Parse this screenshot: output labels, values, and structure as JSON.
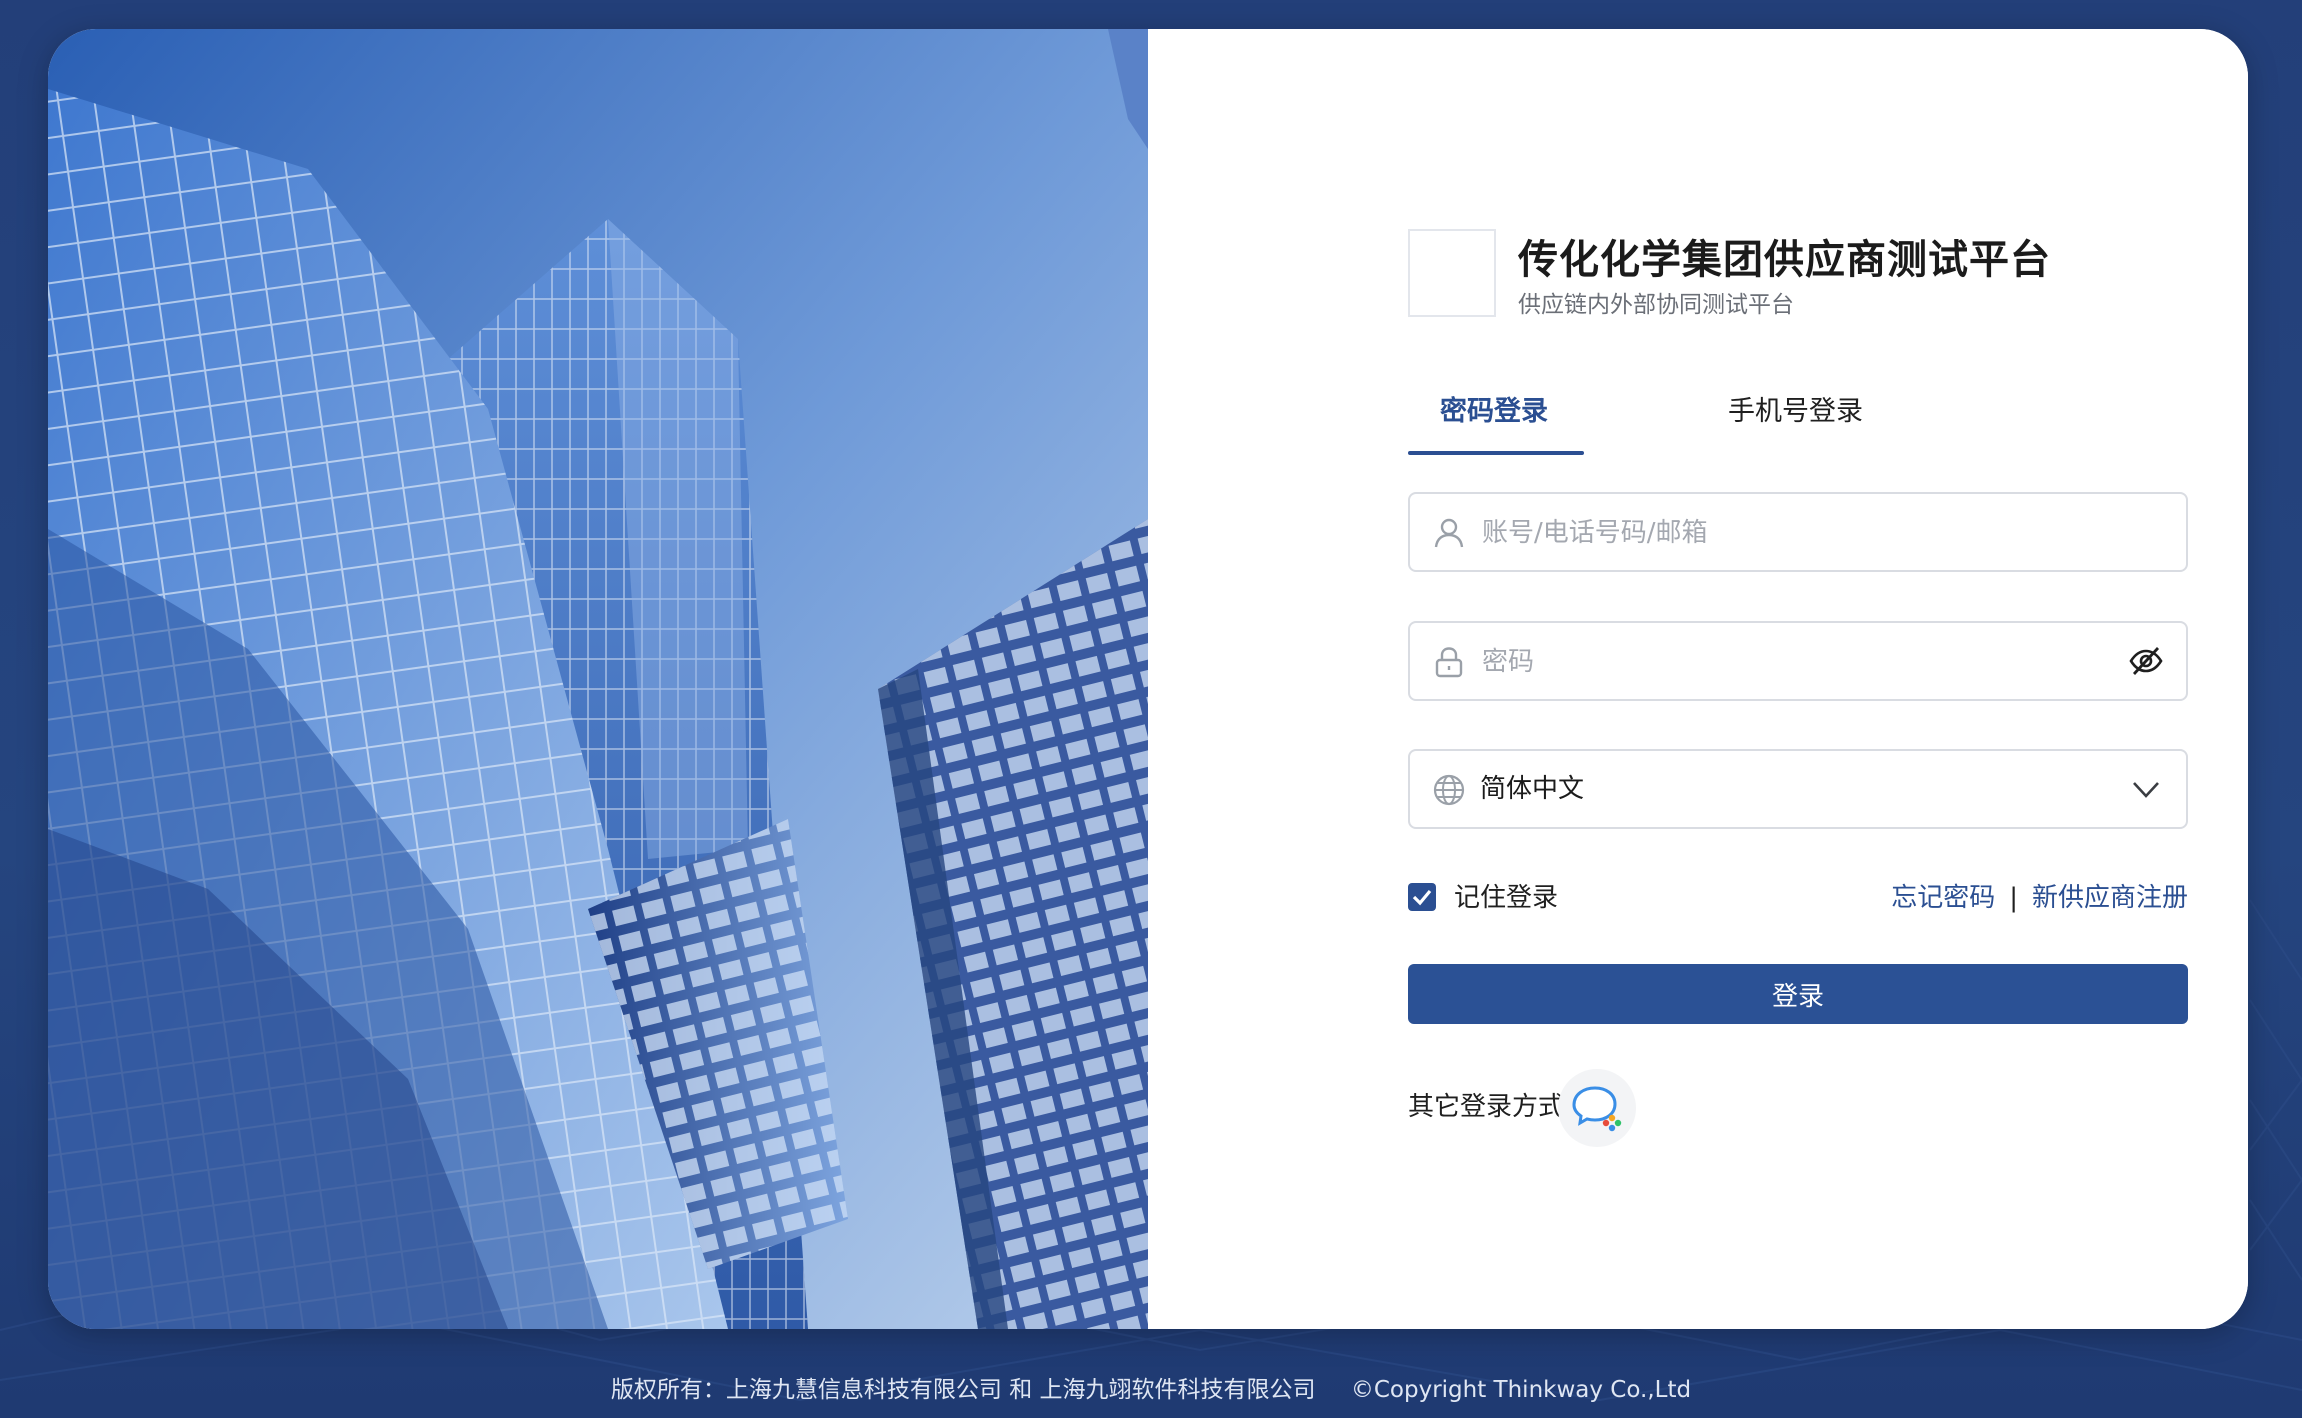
{
  "header": {
    "title": "传化化学集团供应商测试平台",
    "subtitle": "供应链内外部协同测试平台"
  },
  "tabs": [
    {
      "label": "密码登录",
      "active": true
    },
    {
      "label": "手机号登录",
      "active": false
    }
  ],
  "form": {
    "account_placeholder": "账号/电话号码/邮箱",
    "account_value": "",
    "password_placeholder": "密码",
    "password_value": "",
    "language_value": "简体中文",
    "remember_label": "记住登录",
    "remember_checked": true,
    "forgot_label": "忘记密码",
    "separator": "|",
    "register_label": "新供应商注册",
    "login_label": "登录",
    "other_login_label": "其它登录方式:"
  },
  "footer": {
    "copyright_cn": "版权所有：上海九慧信息科技有限公司 和 上海九翊软件科技有限公司",
    "copyright_en": "©Copyright Thinkway Co.,Ltd"
  },
  "colors": {
    "accent": "#2b4f92",
    "button": "#2b5195",
    "background": "#233f79"
  },
  "icons": {
    "account": "user-icon",
    "password": "lock-icon",
    "toggle": "eye-off-icon",
    "language": "globe-icon",
    "dropdown": "chevron-down-icon",
    "checkbox": "checkmark-icon",
    "social": "wechat-work-icon"
  }
}
